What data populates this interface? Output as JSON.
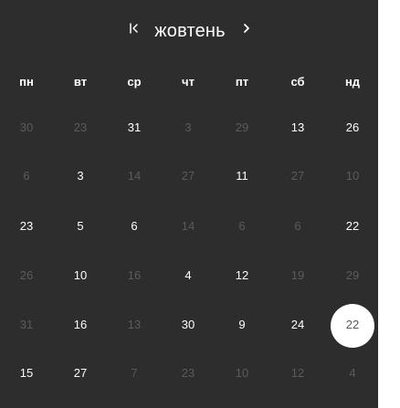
{
  "calendar": {
    "month_label": "жовтень",
    "prev_label": "⇤",
    "next_label": "›",
    "weekdays": [
      "пн",
      "вт",
      "ср",
      "чт",
      "пт",
      "сб",
      "нд"
    ],
    "rows": [
      [
        {
          "label": "30",
          "state": "muted"
        },
        {
          "label": "23",
          "state": "muted"
        },
        {
          "label": "31",
          "state": "normal"
        },
        {
          "label": "3",
          "state": "muted"
        },
        {
          "label": "29",
          "state": "muted"
        },
        {
          "label": "13",
          "state": "normal"
        },
        {
          "label": "26",
          "state": "normal"
        }
      ],
      [
        {
          "label": "6",
          "state": "muted"
        },
        {
          "label": "3",
          "state": "normal"
        },
        {
          "label": "14",
          "state": "muted"
        },
        {
          "label": "27",
          "state": "muted"
        },
        {
          "label": "11",
          "state": "normal"
        },
        {
          "label": "27",
          "state": "muted"
        },
        {
          "label": "10",
          "state": "muted"
        }
      ],
      [
        {
          "label": "23",
          "state": "normal"
        },
        {
          "label": "5",
          "state": "normal"
        },
        {
          "label": "6",
          "state": "normal"
        },
        {
          "label": "14",
          "state": "muted"
        },
        {
          "label": "6",
          "state": "muted"
        },
        {
          "label": "6",
          "state": "muted"
        },
        {
          "label": "22",
          "state": "normal"
        }
      ],
      [
        {
          "label": "26",
          "state": "muted"
        },
        {
          "label": "10",
          "state": "normal"
        },
        {
          "label": "16",
          "state": "muted"
        },
        {
          "label": "4",
          "state": "normal"
        },
        {
          "label": "12",
          "state": "normal"
        },
        {
          "label": "19",
          "state": "muted"
        },
        {
          "label": "29",
          "state": "muted"
        }
      ],
      [
        {
          "label": "31",
          "state": "muted"
        },
        {
          "label": "16",
          "state": "normal"
        },
        {
          "label": "13",
          "state": "muted"
        },
        {
          "label": "30",
          "state": "normal"
        },
        {
          "label": "9",
          "state": "normal"
        },
        {
          "label": "24",
          "state": "normal"
        },
        {
          "label": "22",
          "state": "selected"
        }
      ],
      [
        {
          "label": "15",
          "state": "normal"
        },
        {
          "label": "27",
          "state": "normal"
        },
        {
          "label": "7",
          "state": "muted"
        },
        {
          "label": "23",
          "state": "muted"
        },
        {
          "label": "10",
          "state": "muted"
        },
        {
          "label": "12",
          "state": "muted"
        },
        {
          "label": "4",
          "state": "muted"
        }
      ]
    ]
  },
  "colors": {
    "background": "#2d2d2d",
    "text": "#ffffff",
    "muted_text": "#5b5b5b",
    "selected_circle": "#ffffff",
    "selected_text": "#5a5a5a"
  },
  "icons": {
    "prev": "bar-left-chevron-icon",
    "next": "chevron-right-icon"
  }
}
